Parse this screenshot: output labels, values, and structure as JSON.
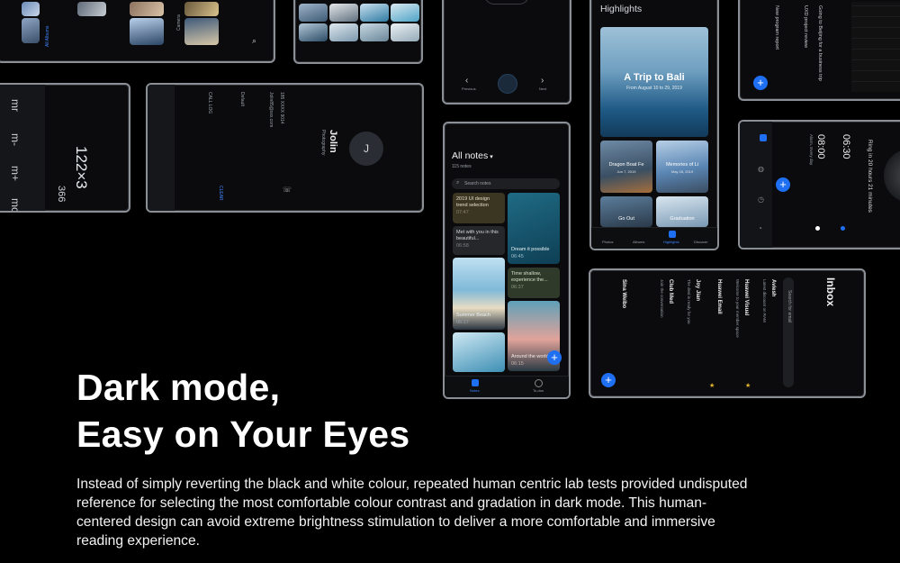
{
  "headline": {
    "line1": "Dark mode,",
    "line2": "Easy on Your Eyes"
  },
  "body": "Instead of simply reverting the black and white colour, repeated human centric lab tests provided undisputed reference for selecting the most comfortable colour contrast and gradation in dark mode. This human-centered design can avoid extreme brightness stimulation to deliver a more comfortable and immersive reading experience.",
  "gallery": {
    "camera_label": "Camera",
    "all_albums": "All Albums"
  },
  "calculator": {
    "display": "122×3",
    "result": "366",
    "keys": [
      "mc",
      "m+",
      "m-",
      "mr"
    ]
  },
  "dialer": {
    "name": "Jolin",
    "subtitle": "Photography",
    "avatar_letter": "J",
    "number": "185 XXXX 9014",
    "email": "Jolin85@xxx.com",
    "clear": "CLEAR",
    "call_log": "CALL LOG",
    "default": "Default"
  },
  "player": {
    "prev": "Previous",
    "next": "Next"
  },
  "notes": {
    "title": "All notes",
    "count": "115 notes",
    "search_placeholder": "Search notes",
    "items": [
      {
        "text": "2019 UI design trend selection",
        "time": "07:47"
      },
      {
        "text": "Met with you in this beautiful...",
        "time": "06:58"
      },
      {
        "text": "Dream it possible",
        "time": "06:45"
      },
      {
        "text": "Time shallow, experience the...",
        "time": "06:37"
      },
      {
        "text": "Summer Beach",
        "time": "06:17"
      },
      {
        "text": "Around the world",
        "time": "06:15"
      }
    ],
    "tabs": [
      "Notes",
      "To-dos"
    ]
  },
  "highlights": {
    "header": "Highlights",
    "hero_title": "A Trip to Bali",
    "hero_date": "From August 10 to 29, 2019",
    "tiles": [
      {
        "title": "Dragon Boat Fe",
        "date": "Jun 7, 2019"
      },
      {
        "title": "Memories of Li",
        "date": "May 28, 2019"
      },
      {
        "title": "Go Out"
      },
      {
        "title": "Graduation"
      }
    ],
    "tabs": [
      "Photos",
      "Albums",
      "Highlights",
      "Discover"
    ]
  },
  "calendar": {
    "item1": "Going to Beijing for a business trip",
    "item2": "New program report",
    "item3": "UXD project review"
  },
  "clock": {
    "time1": "06:30",
    "time2": "08:00",
    "note": "Ring in 20 hours 21 minutes",
    "repeat": "Alarm, Every day"
  },
  "inbox": {
    "title": "Inbox",
    "search_placeholder": "Search for email",
    "senders": [
      "Aviesh",
      "Huawei Visual",
      "Huawei Email",
      "Joy Jian",
      "Club Med",
      "Sina Weibo"
    ],
    "previews": [
      "Latest discount on RAM",
      "Welcome to your member space",
      "The deal is ready for you",
      "Join the conversation"
    ]
  },
  "colors": {
    "accent": "#1f6ff2",
    "frame": "#8b8f96",
    "background": "#000000"
  }
}
